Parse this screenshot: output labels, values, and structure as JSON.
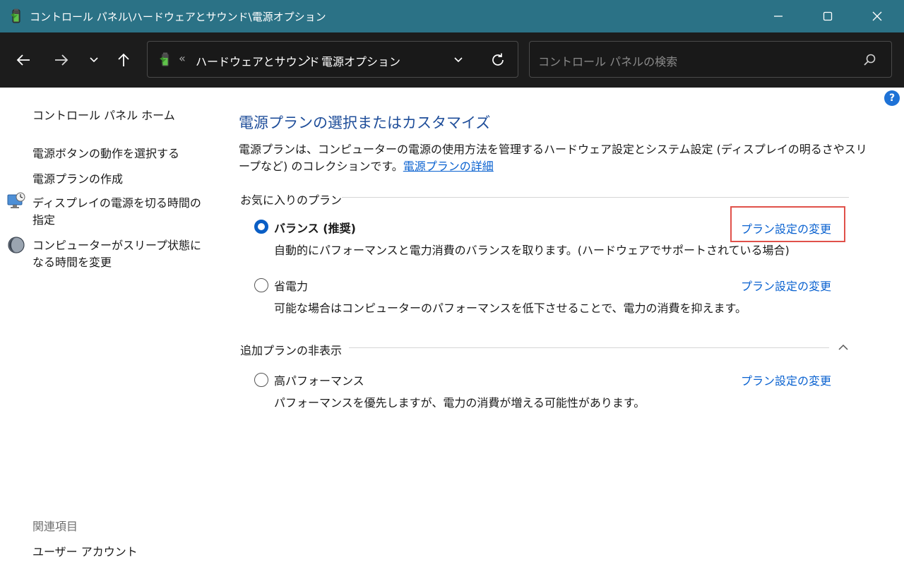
{
  "window": {
    "title": "コントロール パネル\\ハードウェアとサウンド\\電源オプション"
  },
  "nav": {
    "address": {
      "chevron": "«",
      "segment1": "ハードウェアとサウンド",
      "separator": "›",
      "segment2": "電源オプション"
    },
    "search_placeholder": "コントロール パネルの検索"
  },
  "sidebar": {
    "home": "コントロール パネル ホーム",
    "items": [
      "電源ボタンの動作を選択する",
      "電源プランの作成",
      "ディスプレイの電源を切る時間の指定",
      "コンピューターがスリープ状態になる時間を変更"
    ],
    "related_header": "関連項目",
    "related": [
      "ユーザー アカウント"
    ]
  },
  "help": {
    "label": "?"
  },
  "main": {
    "heading": "電源プランの選択またはカスタマイズ",
    "description": "電源プランは、コンピューターの電源の使用方法を管理するハードウェア設定とシステム設定 (ディスプレイの明るさやスリープなど) のコレクションです。",
    "description_link": "電源プランの詳細",
    "favorites_header": "お気に入りのプラン",
    "hidden_header": "追加プランの非表示",
    "plans": [
      {
        "name": "バランス (推奨)",
        "description": "自動的にパフォーマンスと電力消費のバランスを取ります。(ハードウェアでサポートされている場合)",
        "link": "プラン設定の変更",
        "selected": true
      },
      {
        "name": "省電力",
        "description": "可能な場合はコンピューターのパフォーマンスを低下させることで、電力の消費を抑えます。",
        "link": "プラン設定の変更",
        "selected": false
      },
      {
        "name": "高パフォーマンス",
        "description": "パフォーマンスを優先しますが、電力の消費が増える可能性があります。",
        "link": "プラン設定の変更",
        "selected": false
      }
    ]
  },
  "colors": {
    "titlebar": "#2b7286",
    "navbar": "#1c1c1c",
    "heading": "#1f4e9a",
    "link": "#0a62d0",
    "radio_selected": "#0a5ec5",
    "highlight_box": "#e0514a"
  },
  "icons": {
    "title": "power-battery-icon",
    "back": "arrow-left-icon",
    "forward": "arrow-right-icon",
    "recent": "chevron-down-icon",
    "up": "arrow-up-icon",
    "refresh": "refresh-icon",
    "search": "search-icon",
    "display": "display-clock-icon",
    "sleep": "moon-icon",
    "collapse": "chevron-up-icon"
  }
}
